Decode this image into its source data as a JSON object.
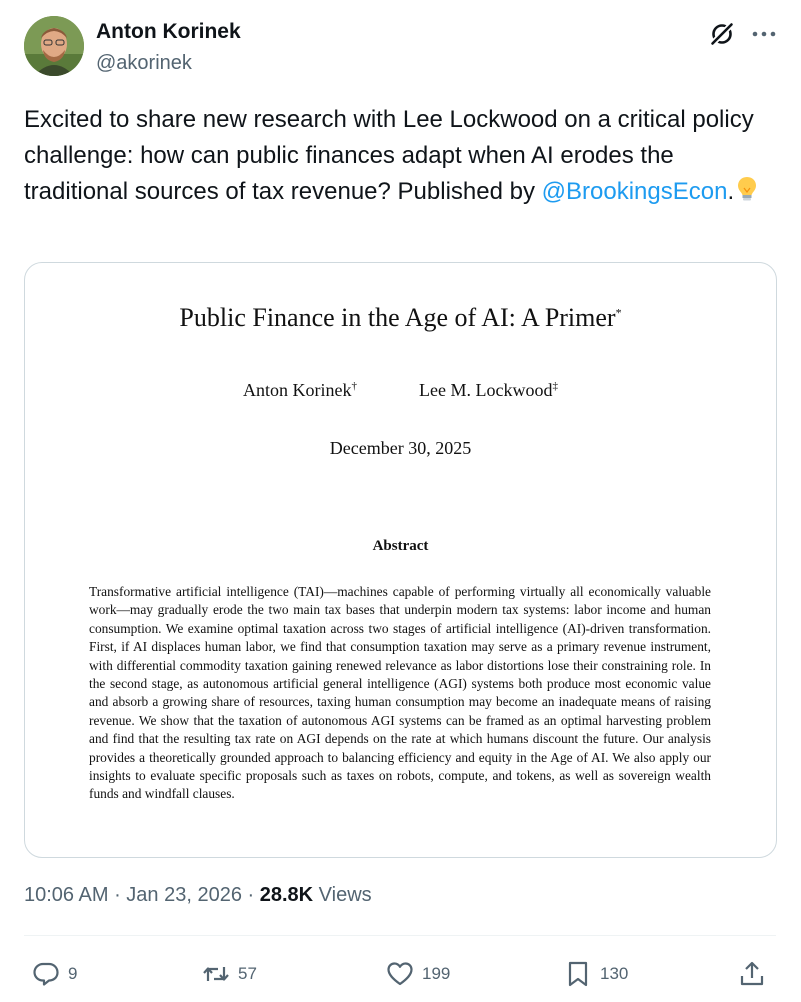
{
  "author": {
    "name": "Anton Korinek",
    "handle": "@akorinek"
  },
  "tweet": {
    "text_before": "Excited to share new research with Lee Lockwood on a critical policy challenge: how can public finances adapt when AI erodes the traditional sources of tax revenue? Published by ",
    "mention": "@BrookingsEcon",
    "text_after": ".",
    "emoji_icon": "lightbulb-icon"
  },
  "paper": {
    "title": "Public Finance in the Age of AI: A Primer",
    "title_mark": "*",
    "authors": [
      {
        "name": "Anton Korinek",
        "mark": "†"
      },
      {
        "name": "Lee M. Lockwood",
        "mark": "‡"
      }
    ],
    "date": "December 30, 2025",
    "abstract_heading": "Abstract",
    "abstract": "Transformative artificial intelligence (TAI)—machines capable of performing virtually all economically valuable work—may gradually erode the two main tax bases that underpin modern tax systems: labor income and human consumption. We examine optimal taxation across two stages of artificial intelligence (AI)-driven transformation. First, if AI displaces human labor, we find that consumption taxation may serve as a primary revenue instrument, with differential commodity taxation gaining renewed relevance as labor distortions lose their constraining role. In the second stage, as autonomous artificial general intelligence (AGI) systems both produce most economic value and absorb a growing share of resources, taxing human consumption may become an inadequate means of raising revenue. We show that the taxation of autonomous AGI systems can be framed as an optimal harvesting problem and find that the resulting tax rate on AGI depends on the rate at which humans discount the future. Our analysis provides a theoretically grounded approach to balancing efficiency and equity in the Age of AI. We also apply our insights to evaluate specific proposals such as taxes on robots, compute, and tokens, as well as sovereign wealth funds and windfall clauses."
  },
  "meta": {
    "time": "10:06 AM",
    "separator": " · ",
    "date": "Jan 23, 2026",
    "views_count": "28.8K",
    "views_label": " Views"
  },
  "actions": {
    "replies": "9",
    "reposts": "57",
    "likes": "199",
    "bookmarks": "130"
  },
  "colors": {
    "link": "#1d9bf0",
    "secondary_text": "#536471",
    "primary_text": "#0f1419",
    "border": "#cfd9de"
  }
}
